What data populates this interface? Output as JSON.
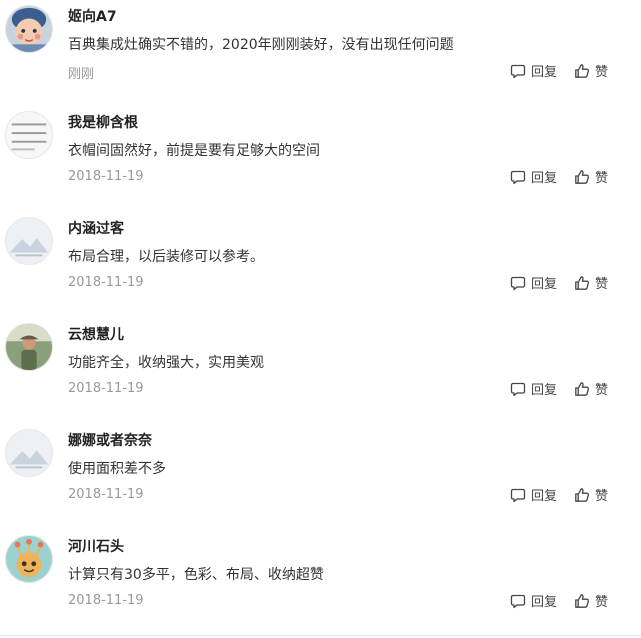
{
  "comments": [
    {
      "username": "姬向A7",
      "text": "百典集成灶确实不错的，2020年刚刚装好，没有出现任何问题",
      "time": "刚刚",
      "avatar_icon": "child-photo-avatar-icon",
      "reply_label": "回复",
      "like_label": "赞"
    },
    {
      "username": "我是柳含根",
      "text": "衣帽间固然好，前提是要有足够大的空间",
      "time": "2018-11-19",
      "avatar_icon": "text-image-avatar-icon",
      "reply_label": "回复",
      "like_label": "赞"
    },
    {
      "username": "内涵过客",
      "text": "布局合理，以后装修可以参考。",
      "time": "2018-11-19",
      "avatar_icon": "mountain-placeholder-avatar-icon",
      "reply_label": "回复",
      "like_label": "赞"
    },
    {
      "username": "云想慧儿",
      "text": "功能齐全，收纳强大，实用美观",
      "time": "2018-11-19",
      "avatar_icon": "outdoor-photo-avatar-icon",
      "reply_label": "回复",
      "like_label": "赞"
    },
    {
      "username": "娜娜或者奈奈",
      "text": "使用面积差不多",
      "time": "2018-11-19",
      "avatar_icon": "mountain-placeholder-avatar-icon",
      "reply_label": "回复",
      "like_label": "赞"
    },
    {
      "username": "河川石头",
      "text": "计算只有30多平，色彩、布局、收纳超赞",
      "time": "2018-11-19",
      "avatar_icon": "cartoon-monster-avatar-icon",
      "reply_label": "回复",
      "like_label": "赞"
    }
  ],
  "colors": {
    "username": "#222222",
    "text": "#333333",
    "time": "#999999",
    "action": "#444444"
  }
}
